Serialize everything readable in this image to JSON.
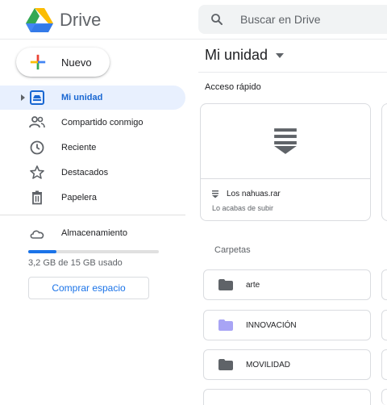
{
  "header": {
    "app_name": "Drive",
    "search_placeholder": "Buscar en Drive"
  },
  "sidebar": {
    "new_button": "Nuevo",
    "items": [
      {
        "label": "Mi unidad",
        "icon": "my-drive-icon",
        "active": true
      },
      {
        "label": "Compartido conmigo",
        "icon": "shared-people-icon",
        "active": false
      },
      {
        "label": "Reciente",
        "icon": "clock-icon",
        "active": false
      },
      {
        "label": "Destacados",
        "icon": "star-icon",
        "active": false
      },
      {
        "label": "Papelera",
        "icon": "trash-icon",
        "active": false
      }
    ],
    "storage": {
      "label": "Almacenamiento",
      "usage_text": "3,2 GB de 15 GB usado",
      "used_fraction": 0.213
    },
    "buy_storage_button": "Comprar espacio"
  },
  "main": {
    "title": "Mi unidad",
    "quick_access": {
      "label": "Acceso rápido",
      "files": [
        {
          "name": "Los nahuas.rar",
          "subtitle": "Lo acabas de subir"
        }
      ]
    },
    "folders": {
      "label": "Carpetas",
      "items": [
        {
          "name": "arte",
          "color": "#5f6368"
        },
        {
          "name": "INNOVACIÓN",
          "color": "#a8a4f5"
        },
        {
          "name": "MOVILIDAD",
          "color": "#5f6368"
        }
      ]
    }
  },
  "colors": {
    "accent": "#1a73e8",
    "active_bg": "#e8f0fe",
    "active_text": "#1967d2"
  }
}
